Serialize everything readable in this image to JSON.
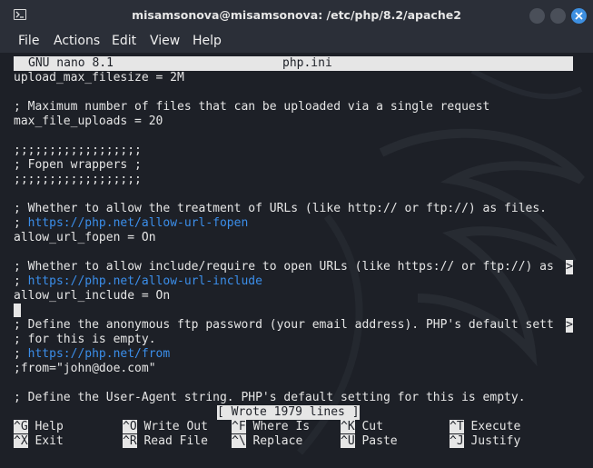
{
  "window": {
    "title": "misamsonova@misamsonova: /etc/php/8.2/apache2"
  },
  "menu": [
    "File",
    "Actions",
    "Edit",
    "View",
    "Help"
  ],
  "nano": {
    "version": "GNU nano 8.1",
    "filename": "php.ini"
  },
  "lines": [
    {
      "text": "upload_max_filesize = 2M",
      "type": "text"
    },
    {
      "text": "",
      "type": "text"
    },
    {
      "text": "; Maximum number of files that can be uploaded via a single request",
      "type": "text"
    },
    {
      "text": "max_file_uploads = 20",
      "type": "text"
    },
    {
      "text": "",
      "type": "text"
    },
    {
      "text": ";;;;;;;;;;;;;;;;;;",
      "type": "text"
    },
    {
      "text": "; Fopen wrappers ;",
      "type": "text"
    },
    {
      "text": ";;;;;;;;;;;;;;;;;;",
      "type": "text"
    },
    {
      "text": "",
      "type": "text"
    },
    {
      "text": "; Whether to allow the treatment of URLs (like http:// or ftp://) as files.",
      "type": "text"
    },
    {
      "text": "https://php.net/allow-url-fopen",
      "type": "link"
    },
    {
      "text": "allow_url_fopen = On",
      "type": "text"
    },
    {
      "text": "",
      "type": "text"
    },
    {
      "text": "; Whether to allow include/require to open URLs (like https:// or ftp://) as",
      "type": "text",
      "truncated": true
    },
    {
      "text": "https://php.net/allow-url-include",
      "type": "link"
    },
    {
      "text": "allow_url_include = On",
      "type": "text"
    },
    {
      "text": "",
      "type": "cursor"
    },
    {
      "text": "; Define the anonymous ftp password (your email address). PHP's default sett",
      "type": "text",
      "truncated": true
    },
    {
      "text": "; for this is empty.",
      "type": "text"
    },
    {
      "text": "https://php.net/from",
      "type": "link"
    },
    {
      "text": ";from=\"john@doe.com\"",
      "type": "text"
    },
    {
      "text": "",
      "type": "text"
    },
    {
      "text": "; Define the User-Agent string. PHP's default setting for this is empty.",
      "type": "text"
    }
  ],
  "status": "[ Wrote 1979 lines ]",
  "shortcuts": [
    {
      "key": "^G",
      "label": "Help"
    },
    {
      "key": "^O",
      "label": "Write Out"
    },
    {
      "key": "^F",
      "label": "Where Is"
    },
    {
      "key": "^K",
      "label": "Cut"
    },
    {
      "key": "^T",
      "label": "Execute"
    },
    {
      "key": "^X",
      "label": "Exit"
    },
    {
      "key": "^R",
      "label": "Read File"
    },
    {
      "key": "^\\",
      "label": "Replace"
    },
    {
      "key": "^U",
      "label": "Paste"
    },
    {
      "key": "^J",
      "label": "Justify"
    }
  ],
  "colors": {
    "background": "#1d2027",
    "text": "#e6e6e6",
    "link": "#3b8eea",
    "close_button": "#3d8fe0"
  },
  "icons": [
    "terminal-icon",
    "minimize-icon",
    "maximize-icon",
    "close-icon"
  ]
}
